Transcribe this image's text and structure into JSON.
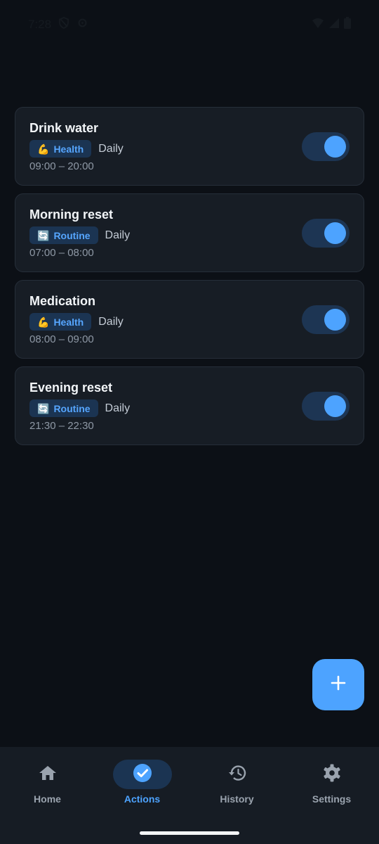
{
  "status_bar": {
    "time": "7:28"
  },
  "actions": [
    {
      "title": "Drink water",
      "tag_icon": "💪",
      "tag": "Health",
      "frequency": "Daily",
      "time_range": "09:00 – 20:00",
      "enabled": true
    },
    {
      "title": "Morning reset",
      "tag_icon": "🔄",
      "tag": "Routine",
      "frequency": "Daily",
      "time_range": "07:00 – 08:00",
      "enabled": true
    },
    {
      "title": "Medication",
      "tag_icon": "💪",
      "tag": "Health",
      "frequency": "Daily",
      "time_range": "08:00 – 09:00",
      "enabled": true
    },
    {
      "title": "Evening reset",
      "tag_icon": "🔄",
      "tag": "Routine",
      "frequency": "Daily",
      "time_range": "21:30 – 22:30",
      "enabled": true
    }
  ],
  "fab": {
    "icon": "plus-icon"
  },
  "nav": {
    "items": [
      {
        "label": "Home",
        "icon": "home-icon",
        "active": false
      },
      {
        "label": "Actions",
        "icon": "check-circle-icon",
        "active": true
      },
      {
        "label": "History",
        "icon": "history-icon",
        "active": false
      },
      {
        "label": "Settings",
        "icon": "gear-icon",
        "active": false
      }
    ]
  },
  "colors": {
    "background": "#0c1016",
    "card": "#171d25",
    "accent": "#4da3ff",
    "tag_bg": "#1b3452"
  }
}
